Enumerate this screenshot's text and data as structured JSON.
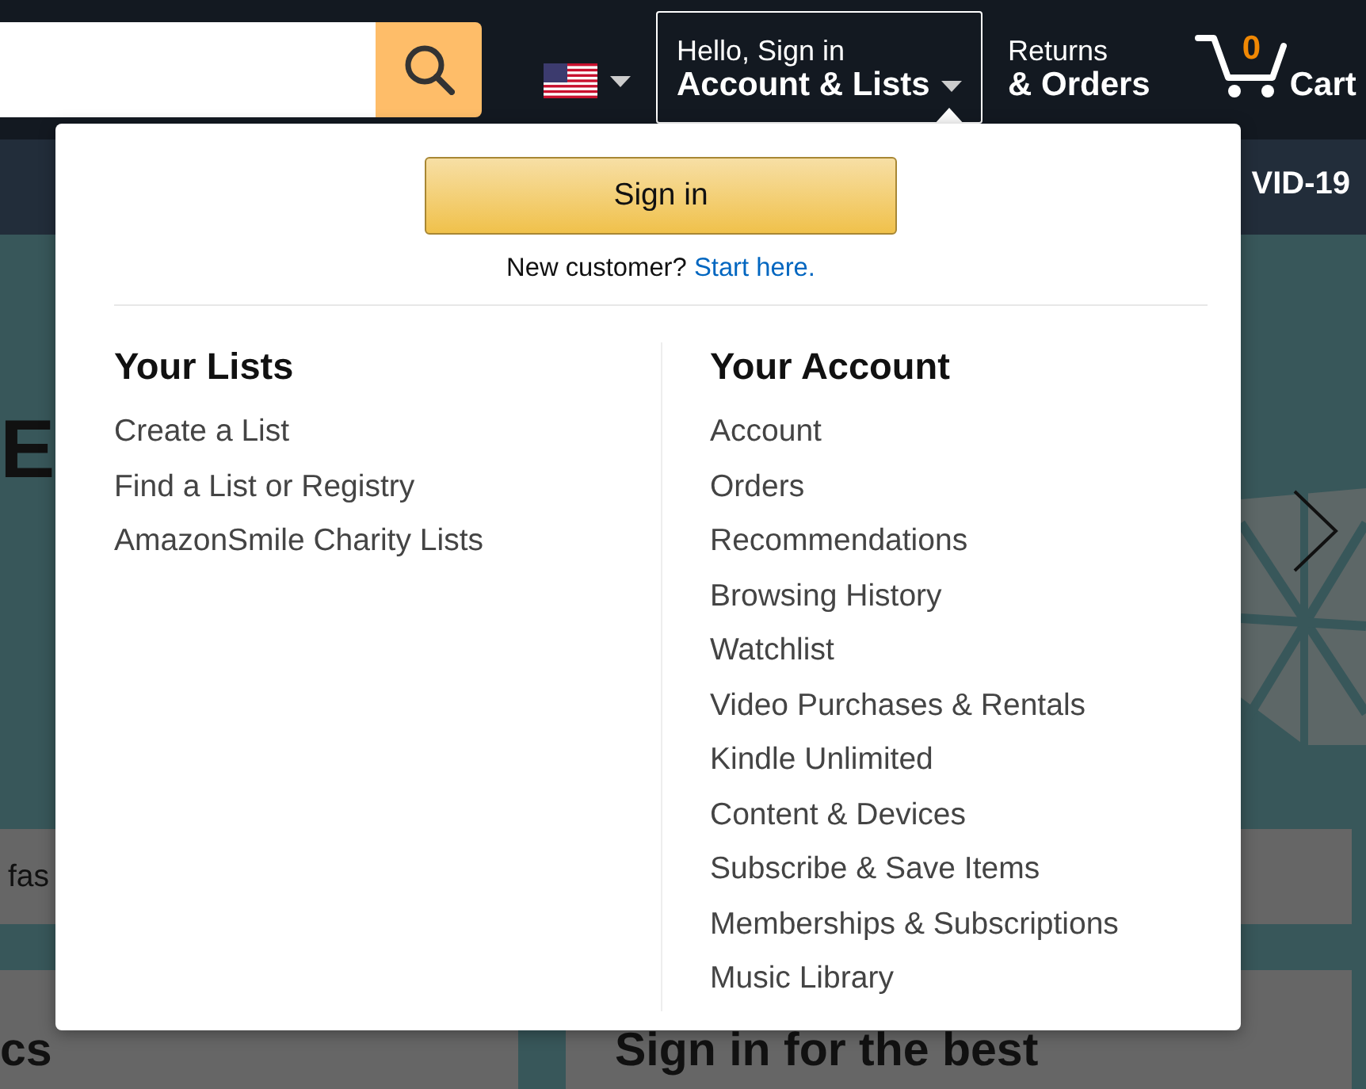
{
  "header": {
    "account_menu": {
      "greeting": "Hello, Sign in",
      "label": "Account & Lists",
      "expanded": true
    },
    "returns": {
      "line_1": "Returns",
      "line_2": "& Orders"
    },
    "cart": {
      "count": "0",
      "label": "Cart"
    }
  },
  "subnav": {
    "text": "VID-19"
  },
  "hero": {
    "headline": "E",
    "banner_text": "fas",
    "cards": [
      {
        "title": "cs"
      },
      {
        "title": "Sign in for the best"
      }
    ]
  },
  "dropdown": {
    "sign_in_button": "Sign in",
    "new_customer": {
      "prompt": "New customer?",
      "link": "Start here."
    },
    "sections": [
      {
        "title": "Your Lists",
        "items": [
          "Create a List",
          "Find a List or Registry",
          "AmazonSmile Charity Lists"
        ]
      },
      {
        "title": "Your Account",
        "items": [
          "Account",
          "Orders",
          "Recommendations",
          "Browsing History",
          "Watchlist",
          "Video Purchases & Rentals",
          "Kindle Unlimited",
          "Content & Devices",
          "Subscribe & Save Items",
          "Memberships & Subscriptions",
          "Music Library"
        ]
      }
    ]
  }
}
